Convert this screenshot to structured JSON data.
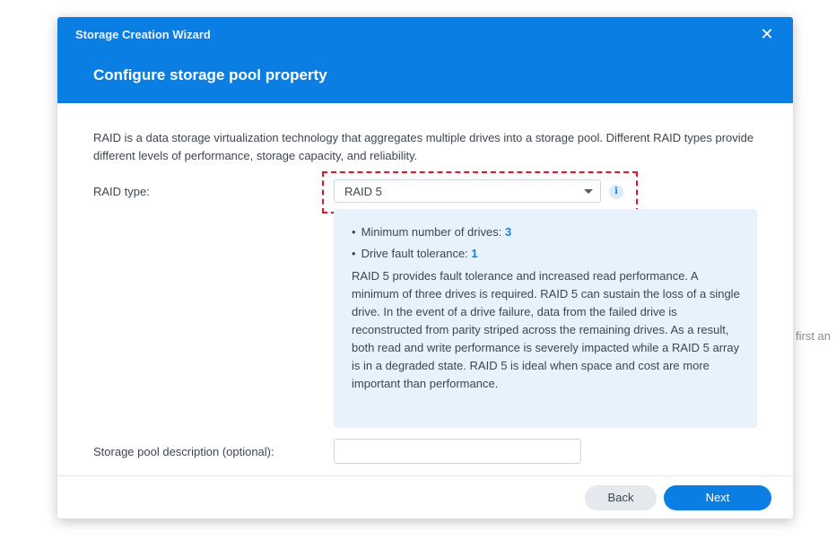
{
  "background": {
    "partial_text": "first an"
  },
  "dialog": {
    "window_title": "Storage Creation Wizard",
    "close_icon": "close-icon",
    "step_title": "Configure storage pool property",
    "intro_text": "RAID is a data storage virtualization technology that aggregates multiple drives into a storage pool. Different RAID types provide different levels of performance, storage capacity, and reliability.",
    "raid_type": {
      "label": "RAID type:",
      "selected": "RAID 5",
      "info_icon": "info-icon"
    },
    "raid_info": {
      "min_drives_label": "Minimum number of drives:",
      "min_drives_value": "3",
      "fault_tolerance_label": "Drive fault tolerance:",
      "fault_tolerance_value": "1",
      "description": "RAID 5 provides fault tolerance and increased read performance. A minimum of three drives is required. RAID 5 can sustain the loss of a single drive. In the event of a drive failure, data from the failed drive is reconstructed from parity striped across the remaining drives. As a result, both read and write performance is severely impacted while a RAID 5 array is in a degraded state. RAID 5 is ideal when space and cost are more important than performance."
    },
    "description_field": {
      "label": "Storage pool description (optional):",
      "value": "",
      "placeholder": ""
    },
    "footer": {
      "back_label": "Back",
      "next_label": "Next"
    }
  },
  "colors": {
    "accent": "#0a7ee3",
    "info_panel": "#e7f2fc",
    "highlight": "#e3112a"
  }
}
